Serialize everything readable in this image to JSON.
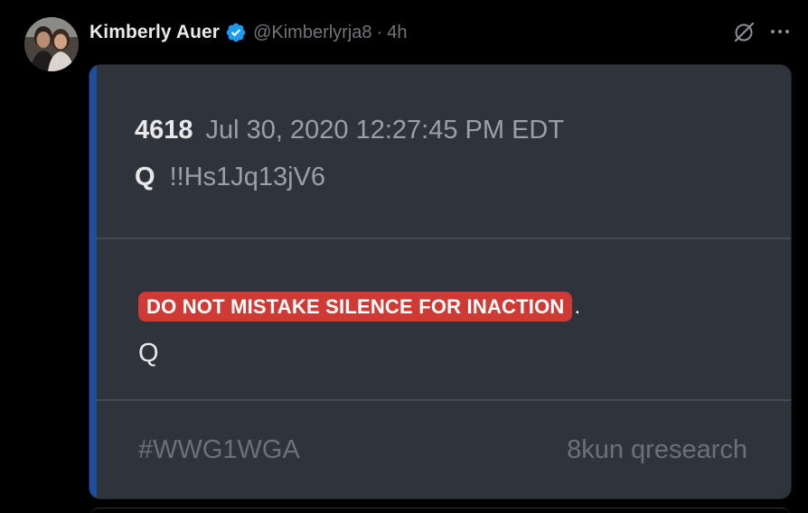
{
  "author": {
    "name": "Kimberly Auer",
    "handle": "@Kimberlyrja8",
    "separator": "·",
    "time": "4h",
    "verified_color": "#1d9bf0"
  },
  "icons": {
    "grok": "grok-icon",
    "more": "more-icon",
    "verified": "verified-badge-icon"
  },
  "card": {
    "post_number": "4618",
    "post_date": "Jul 30, 2020 12:27:45 PM EDT",
    "author_name": "Q",
    "tripcode": "!!Hs1Jq13jV6",
    "highlight_text": "DO NOT MISTAKE SILENCE FOR INACTION",
    "trailing_period": ".",
    "signature": "Q",
    "hashtag": "#WWG1WGA",
    "source": "8kun qresearch",
    "accent_color": "#1d4fa0",
    "highlight_color": "#cf3a35",
    "background_color": "#2f343c"
  }
}
